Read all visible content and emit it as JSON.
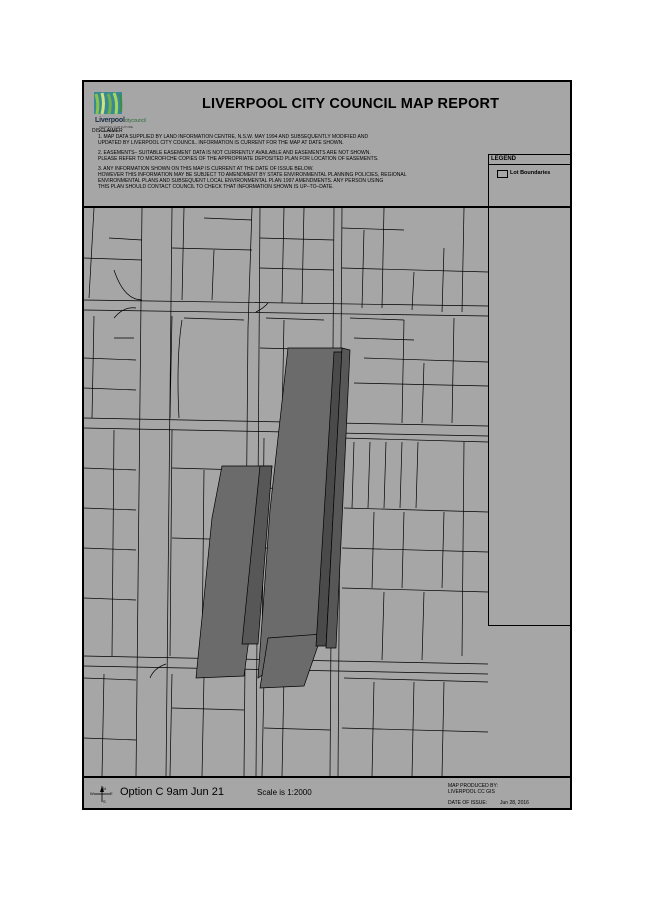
{
  "report": {
    "title": "LIVERPOOL CITY COUNCIL MAP REPORT",
    "logo_word": "Liverpool",
    "logo_suffix": "citycouncil",
    "logo_tagline": "SHAPING OUR FUTURE TOGETHER"
  },
  "disclaimer": {
    "heading": "DISCLAIMER",
    "paragraphs": [
      "1. MAP DATA SUPPLIED BY LAND INFORMATION CENTRE, N.S.W. MAY 1994 AND SUBSEQUENTLY MODIFIED AND\nUPDATED BY LIVERPOOL CITY COUNCIL. INFORMATION IS CURRENT FOR THE MAP AT DATE SHOWN.",
      "2. EASEMENTS– SUITABLE EASEMENT DATA IS NOT CURRENTLY AVAILABLE AND EASEMENTS ARE NOT SHOWN.\nPLEASE REFER TO MICROFICHE COPIES OF THE APPROPRIATE DEPOSITED PLAN FOR LOCATION OF EASEMENTS.",
      "3. ANY INFORMATION SHOWN ON THIS MAP IS CURRENT AT THE DATE OF ISSUE BELOW.\nHOWEVER THIS INFORMATION MAY BE SUBJECT TO AMENDMENT BY STATE ENVIRONMENTAL PLANNING POLICIES, REGIONAL\nENVIRONMENTAL PLANS AND SUBSEQUENT LOCAL ENVIRONMENTAL PLAN 1997 AMENDMENTS. ANY PERSON USING\nTHIS PLAN SHOULD CONTACT COUNCIL TO CHECK THAT INFORMATION SHOWN IS UP–TO–DATE."
    ]
  },
  "legend": {
    "title": "LEGEND",
    "items": [
      {
        "label": "Lot Boundaries"
      }
    ]
  },
  "footer": {
    "option_label": "Option C 9am Jun 21",
    "scale": "Scale is 1:2000",
    "produced_by": "MAP PRODUCED BY:\nLIVERPOOL CC GIS",
    "date_label": "DATE OF ISSUE:",
    "date_value": "Jun 28, 2016",
    "north": {
      "n": "N",
      "s": "S",
      "e": "E",
      "w": "W"
    }
  },
  "colors": {
    "map_background": "#a6a6a6",
    "shadow": "#6b6b6b",
    "building": "#555555",
    "line": "#000000"
  }
}
